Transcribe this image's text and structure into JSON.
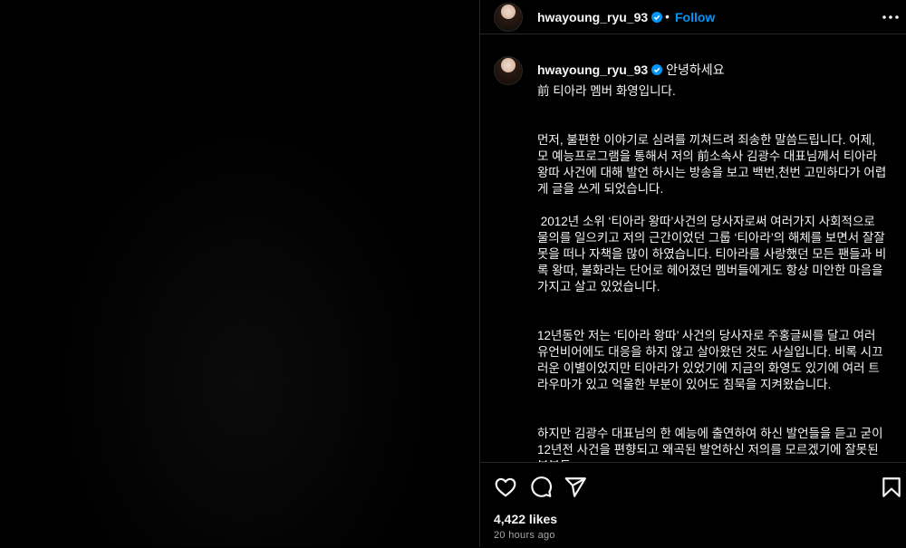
{
  "post": {
    "username": "hwayoung_ryu_93",
    "follow_label": "Follow",
    "separator": "•",
    "caption_first_line": "안녕하세요",
    "caption_body": "前 티아라 멤버 화영입니다.\n\n\n먼저, 불편한 이야기로 심려를 끼쳐드려 죄송한 말씀드립니다. 어제, 모 예능프로그램을 통해서 저의 前소속사 김광수 대표님께서 티아라 왕따 사건에 대해 발언 하시는 방송을 보고 백번,천번 고민하다가 어렵게 글을 쓰게 되었습니다.\n\n 2012년 소위 ‘티아라 왕따’사건의 당사자로써 여러가지 사회적으로 물의를 일으키고 저의 근간이었던 그룹 ‘티아라’의 해체를 보면서 잘잘못을 떠나 자책을 많이 하였습니다. 티아라를 사랑했던 모든 팬들과 비록 왕따, 불화라는 단어로 헤어졌던 멤버들에게도 항상 미안한 마음을 가지고 살고 있었습니다.\n\n\n12년동안 저는 ‘티아라 왕따’ 사건의 당사자로 주홍글씨를 달고 여러 유언비어에도 대응을 하지 않고 살아왔던 것도 사실입니다. 비록 시끄러운 이별이었지만 티아라가 있었기에 지금의 화영도 있기에 여러 트라우마가 있고 억울한 부분이 있어도 침묵을 지켜왔습니다.\n\n\n하지만 김광수 대표님의 한 예능에 출연하여 하신 발언들을 듣고 굳이 12년전 사건을 편향되고 왜곡된 발언하신 저의를 모르겠기에 잘못된 부분들",
    "likes": "4,422 likes",
    "timestamp": "20 hours ago"
  },
  "icons": {
    "verified": "verified-badge-icon",
    "more": "more-options-icon",
    "like": "heart-icon",
    "comment": "comment-icon",
    "share": "share-icon",
    "save": "bookmark-icon"
  },
  "colors": {
    "accent": "#0095f6",
    "background": "#000000",
    "text": "#f5f5f5",
    "secondary_text": "#a8a8a8",
    "divider": "#262626"
  }
}
